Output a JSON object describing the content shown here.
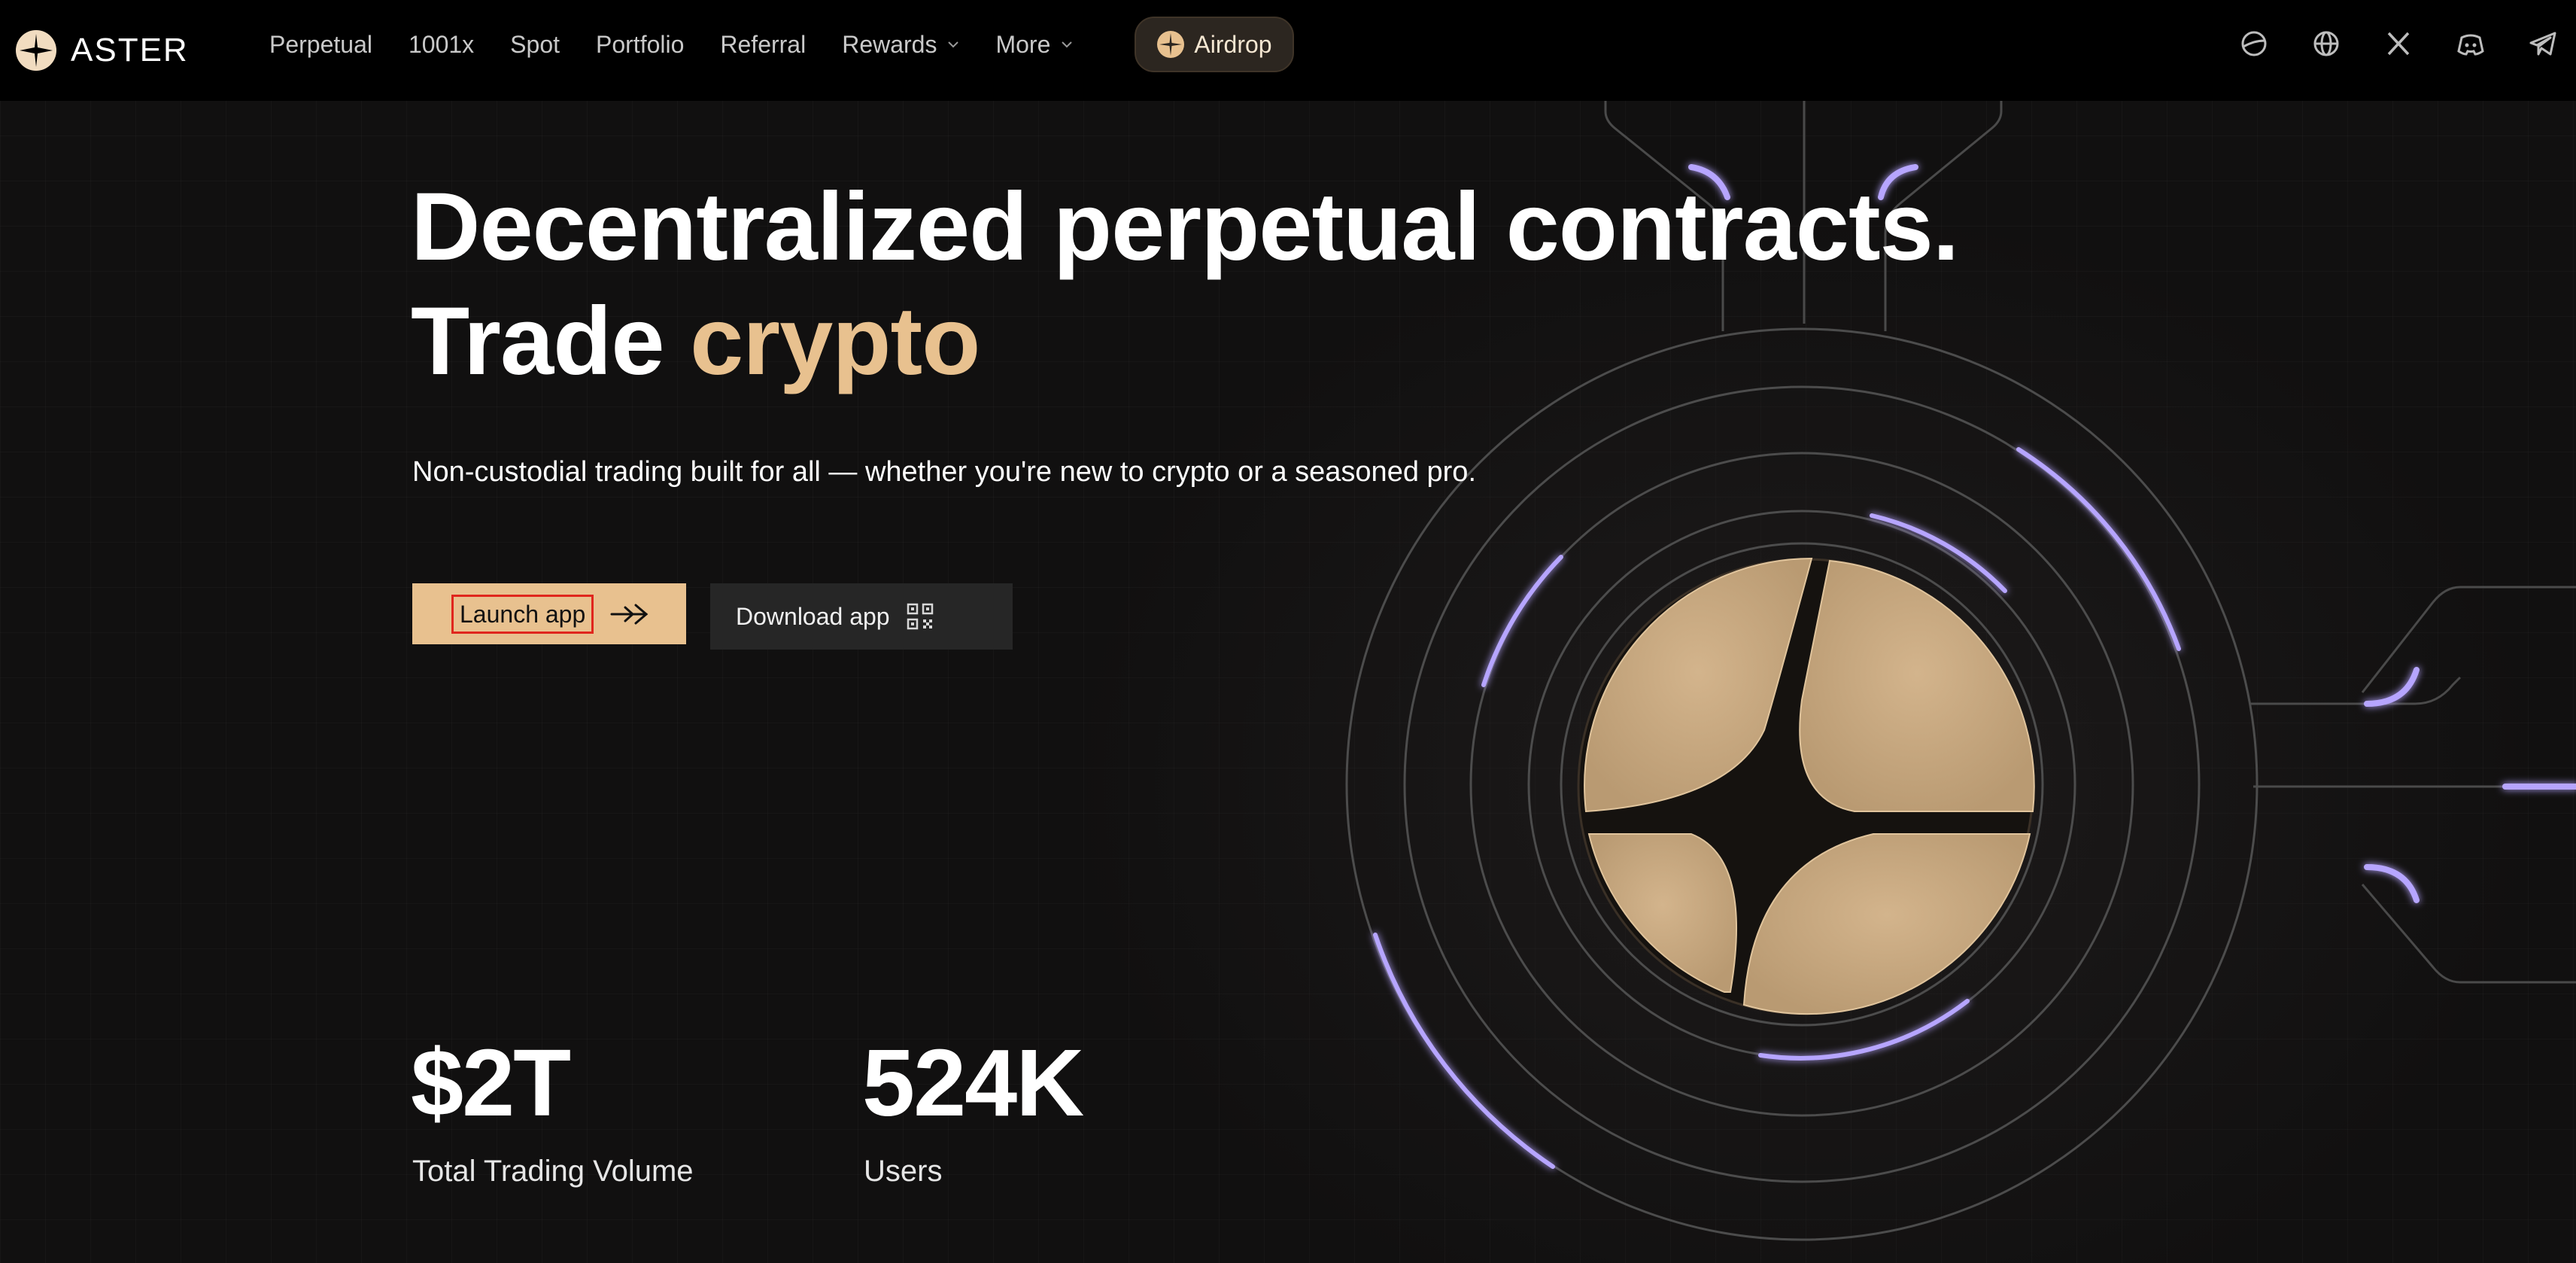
{
  "brand": {
    "name": "ASTER"
  },
  "nav": {
    "items": [
      {
        "label": "Perpetual"
      },
      {
        "label": "1001x"
      },
      {
        "label": "Spot"
      },
      {
        "label": "Portfolio"
      },
      {
        "label": "Referral"
      },
      {
        "label": "Rewards",
        "dropdown": true
      },
      {
        "label": "More",
        "dropdown": true
      }
    ],
    "airdrop_label": "Airdrop",
    "social_icons": [
      "theme-icon",
      "globe-icon",
      "x-icon",
      "discord-icon",
      "telegram-icon"
    ]
  },
  "hero": {
    "headline_line1": "Decentralized perpetual contracts.",
    "headline_line2_prefix": "Trade ",
    "headline_line2_accent": "crypto",
    "subtitle": "Non-custodial trading built for all — whether you're new to crypto or a seasoned pro.",
    "launch_label": "Launch app",
    "download_label": "Download app"
  },
  "stats": [
    {
      "value": "$2T",
      "label": "Total Trading Volume"
    },
    {
      "value": "524K",
      "label": "Users"
    }
  ],
  "colors": {
    "accent": "#e8c18f",
    "background": "#111010",
    "nav_background": "#000000",
    "glow": "#b6a5ff",
    "coin": "#c8a982"
  }
}
